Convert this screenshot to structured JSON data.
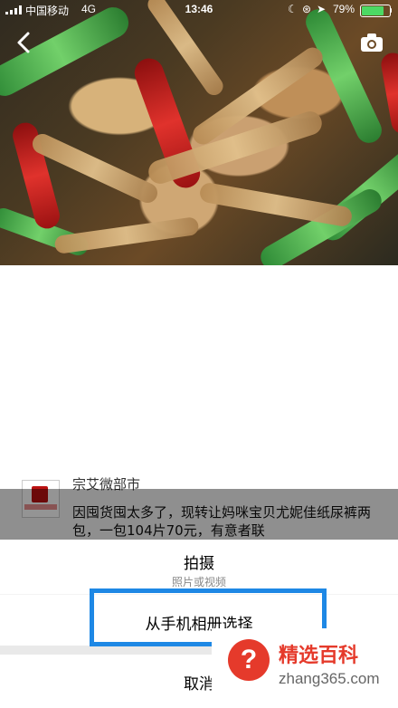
{
  "status_bar": {
    "carrier": "中国移动",
    "network": "4G",
    "time": "13:46",
    "battery": "79%",
    "icons": [
      "signal-icon",
      "moon-icon",
      "lock-rotation-icon",
      "location-arrow-icon",
      "battery-icon"
    ]
  },
  "header": {
    "icons": [
      "back-icon",
      "camera-icon"
    ]
  },
  "background_page": {
    "shop_name": "宗艾微部市",
    "post_text": "因囤货囤太多了，现转让妈咪宝贝尤妮佳纸尿裤两包，一包104片70元，有意者联"
  },
  "action_sheet": {
    "shoot_label": "拍摄",
    "shoot_sub": "照片或视频",
    "album_label": "从手机相册选择",
    "cancel_label": "取消"
  },
  "watermark": {
    "brand": "精选百科",
    "site": "zhang365.com",
    "symbol": "?"
  },
  "colors": {
    "highlight": "#1e88e5",
    "watermark_red": "#e53a2b"
  }
}
